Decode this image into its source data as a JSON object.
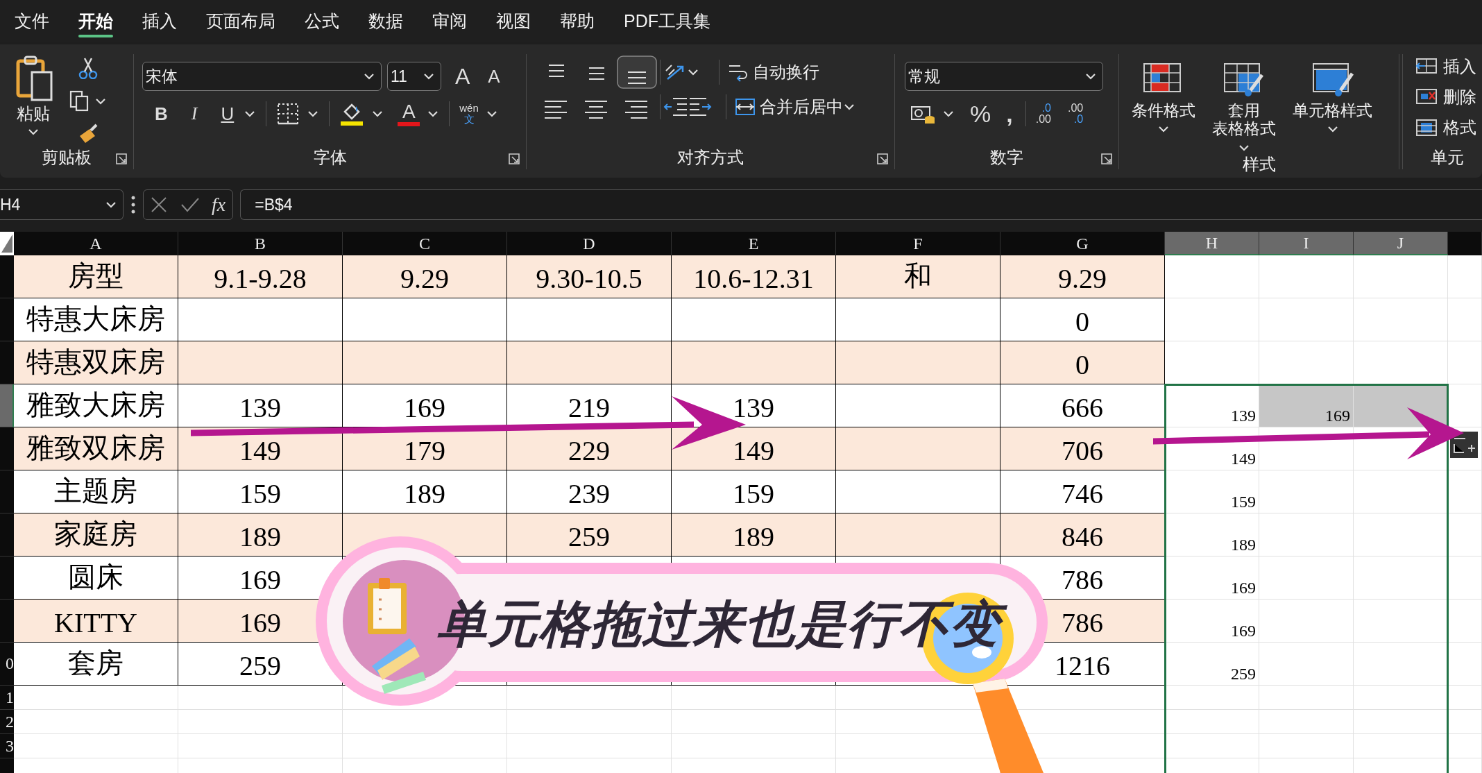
{
  "menu": {
    "tabs": [
      {
        "label": "文件",
        "selected": false
      },
      {
        "label": "开始",
        "selected": true
      },
      {
        "label": "插入",
        "selected": false
      },
      {
        "label": "页面布局",
        "selected": false
      },
      {
        "label": "公式",
        "selected": false
      },
      {
        "label": "数据",
        "selected": false
      },
      {
        "label": "审阅",
        "selected": false
      },
      {
        "label": "视图",
        "selected": false
      },
      {
        "label": "帮助",
        "selected": false
      },
      {
        "label": "PDF工具集",
        "selected": false
      }
    ]
  },
  "ribbon": {
    "clipboard": {
      "label": "剪贴板",
      "paste": "粘贴"
    },
    "font": {
      "label": "字体",
      "font_name": "宋体",
      "font_size": "11",
      "grow": "A",
      "shrink": "A",
      "bold": "B",
      "italic": "I",
      "underline": "U",
      "font_color": "A",
      "phonetic_top": "wén",
      "phonetic_bottom": "文"
    },
    "alignment": {
      "label": "对齐方式",
      "wrap_text": "自动换行",
      "merge_center": "合并后居中"
    },
    "number": {
      "label": "数字",
      "format": "常规",
      "percent": "%",
      "comma": ",",
      "increase_decimal": {
        "top": ".0",
        "bottom": ".00"
      },
      "decrease_decimal": {
        "top": ".00",
        "bottom": ".0"
      }
    },
    "styles": {
      "label": "样式",
      "buttons": [
        {
          "lines": [
            "条件格式"
          ],
          "kind": "conditional"
        },
        {
          "lines": [
            "套用",
            "表格格式"
          ],
          "kind": "table"
        },
        {
          "lines": [
            "单元格样式"
          ],
          "kind": "cellstyle"
        }
      ]
    },
    "cells": {
      "label": "单元",
      "buttons": [
        {
          "label": "插入",
          "kind": "insert"
        },
        {
          "label": "删除",
          "kind": "delete"
        },
        {
          "label": "格式",
          "kind": "format"
        }
      ]
    }
  },
  "formula_bar": {
    "name_box": "H4",
    "function_label": "fx",
    "formula": "=B$4"
  },
  "sheet": {
    "columns": [
      {
        "label": "A",
        "selected": false
      },
      {
        "label": "B",
        "selected": false
      },
      {
        "label": "C",
        "selected": false
      },
      {
        "label": "D",
        "selected": false
      },
      {
        "label": "E",
        "selected": false
      },
      {
        "label": "F",
        "selected": false
      },
      {
        "label": "G",
        "selected": false
      },
      {
        "label": "H",
        "selected": true
      },
      {
        "label": "I",
        "selected": true
      },
      {
        "label": "J",
        "selected": true
      }
    ],
    "rows": [
      {
        "header_selected": false,
        "shaded": true,
        "cells": [
          "房型",
          "9.1-9.28",
          "9.29",
          "9.30-10.5",
          "10.6-12.31",
          "和",
          "9.29"
        ],
        "extra": [
          {
            "selected": false
          },
          {
            "selected": false
          },
          {
            "selected": false
          }
        ]
      },
      {
        "header_selected": false,
        "shaded": false,
        "cells": [
          "特惠大床房",
          null,
          null,
          null,
          null,
          null,
          "0"
        ],
        "extra": [
          {
            "selected": false
          },
          {
            "selected": false
          },
          {
            "selected": false
          }
        ]
      },
      {
        "header_selected": false,
        "shaded": true,
        "cells": [
          "特惠双床房",
          null,
          null,
          null,
          null,
          null,
          "0"
        ],
        "extra": [
          {
            "selected": false
          },
          {
            "selected": false
          },
          {
            "selected": false
          }
        ]
      },
      {
        "header_selected": true,
        "shaded": false,
        "cells": [
          "雅致大床房",
          "139",
          "169",
          "219",
          "139",
          null,
          "666"
        ],
        "extra": [
          {
            "text": "139",
            "selected": true
          },
          {
            "text": "169",
            "selected": true
          },
          {
            "selected": true
          }
        ]
      },
      {
        "header_selected": false,
        "shaded": true,
        "cells": [
          "雅致双床房",
          "149",
          "179",
          "229",
          "149",
          null,
          "706"
        ],
        "extra": [
          {
            "text": "149",
            "selected": false
          },
          {
            "selected": false
          },
          {
            "selected": false
          }
        ]
      },
      {
        "header_selected": false,
        "shaded": false,
        "cells": [
          "主题房",
          "159",
          "189",
          "239",
          "159",
          null,
          "746"
        ],
        "extra": [
          {
            "text": "159",
            "selected": false
          },
          {
            "selected": false
          },
          {
            "selected": false
          }
        ]
      },
      {
        "header_selected": false,
        "shaded": true,
        "cells": [
          "家庭房",
          "189",
          null,
          "259",
          "189",
          null,
          "846"
        ],
        "extra": [
          {
            "text": "189",
            "selected": false
          },
          {
            "selected": false
          },
          {
            "selected": false
          }
        ]
      },
      {
        "header_selected": false,
        "shaded": false,
        "cells": [
          "圆床",
          "169",
          null,
          null,
          null,
          null,
          "786"
        ],
        "extra": [
          {
            "text": "169",
            "selected": false
          },
          {
            "selected": false
          },
          {
            "selected": false
          }
        ]
      },
      {
        "header_selected": false,
        "shaded": true,
        "cells": [
          "KITTY",
          "169",
          null,
          null,
          null,
          null,
          "786"
        ],
        "extra": [
          {
            "text": "169",
            "selected": false
          },
          {
            "selected": false
          },
          {
            "selected": false
          }
        ]
      },
      {
        "header": "0",
        "header_selected": false,
        "shaded": false,
        "cells": [
          "套房",
          "259",
          null,
          null,
          null,
          null,
          "1216"
        ],
        "extra": [
          {
            "text": "259",
            "selected": false
          },
          {
            "selected": false
          },
          {
            "selected": false
          }
        ]
      },
      {
        "header": "1",
        "header_selected": false,
        "shaded": false,
        "extra": [
          {
            "selected": false
          },
          {
            "selected": false
          },
          {
            "selected": false
          }
        ]
      },
      {
        "header": "2",
        "header_selected": false,
        "shaded": false,
        "extra": [
          {
            "selected": false
          },
          {
            "selected": false
          },
          {
            "selected": false
          }
        ]
      },
      {
        "header": "3",
        "header_selected": false,
        "shaded": false,
        "extra": [
          {
            "selected": false
          },
          {
            "selected": false
          },
          {
            "selected": false
          }
        ]
      }
    ]
  },
  "caption": {
    "text": "单元格拖过来也是行不变"
  }
}
